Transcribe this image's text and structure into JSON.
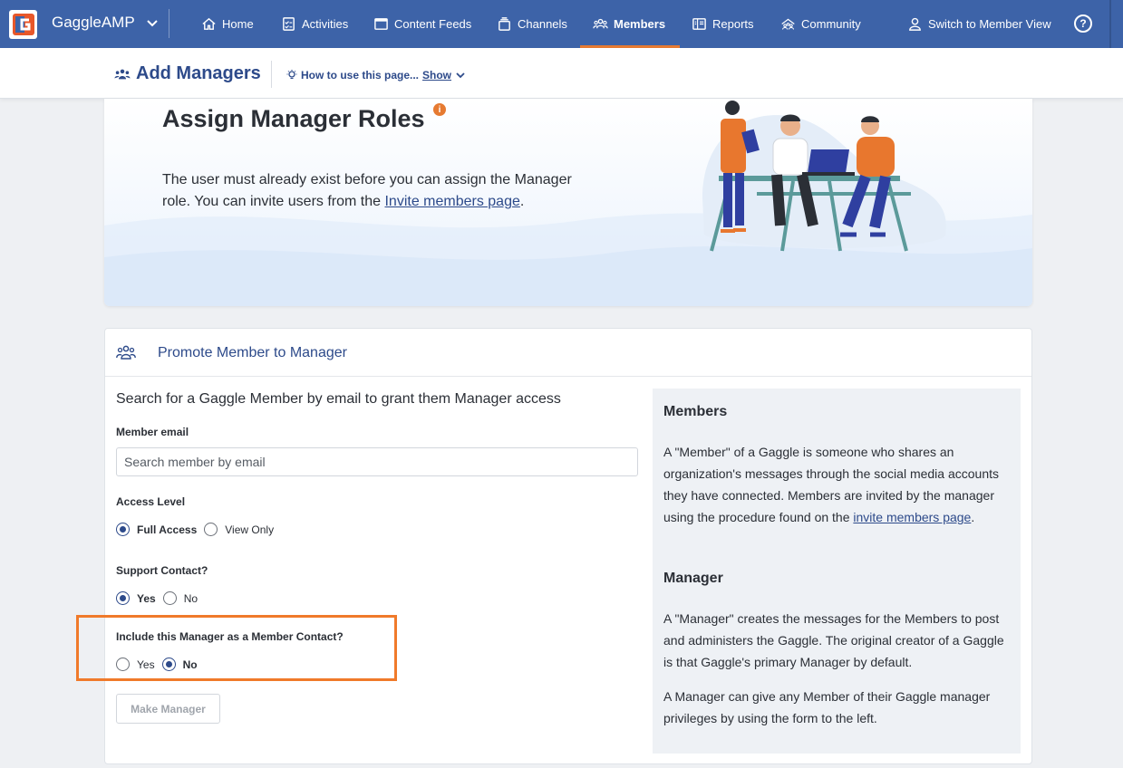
{
  "nav": {
    "brand": "GaggleAMP",
    "items": [
      {
        "label": "Home",
        "icon": "home-icon"
      },
      {
        "label": "Activities",
        "icon": "checklist-icon"
      },
      {
        "label": "Content Feeds",
        "icon": "feed-icon"
      },
      {
        "label": "Channels",
        "icon": "layers-icon"
      },
      {
        "label": "Members",
        "icon": "people-icon"
      },
      {
        "label": "Reports",
        "icon": "book-icon"
      },
      {
        "label": "Community",
        "icon": "community-icon"
      }
    ],
    "active": "Members",
    "member_view": "Switch to Member View",
    "help": "?"
  },
  "subheader": {
    "title": "Add Managers",
    "howto": "How to use this page...",
    "show": "Show"
  },
  "hero": {
    "title": "Assign Manager Roles",
    "text_before": "The user must already exist before you can assign the Manager role. You can invite users from the ",
    "link": "Invite members page",
    "text_after": "."
  },
  "card": {
    "title": "Promote Member to Manager",
    "search_desc": "Search for a Gaggle Member by email to grant them Manager access",
    "email_label": "Member email",
    "email_placeholder": "Search member by email",
    "access_label": "Access Level",
    "access_options": [
      "Full Access",
      "View Only"
    ],
    "access_selected": "Full Access",
    "support_label": "Support Contact?",
    "support_options": [
      "Yes",
      "No"
    ],
    "support_selected": "Yes",
    "contact_label": "Include this Manager as a Member Contact?",
    "contact_options": [
      "Yes",
      "No"
    ],
    "contact_selected": "No",
    "submit": "Make Manager"
  },
  "sidebar": {
    "members_title": "Members",
    "members_text": "A \"Member\" of a Gaggle is someone who shares an organization's messages through the social media accounts they have connected. Members are invited by the manager using the procedure found on the ",
    "members_link": "invite members page",
    "members_text_end": ".",
    "manager_title": "Manager",
    "manager_text1": "A \"Manager\" creates the messages for the Members to post and administers the Gaggle. The original creator of a Gaggle is that Gaggle's primary Manager by default.",
    "manager_text2": "A Manager can give any Member of their Gaggle manager privileges by using the form to the left."
  },
  "colors": {
    "nav": "#3d63a8",
    "accent": "#e67a31",
    "primary": "#2d4a8a",
    "highlight": "#f07a2a"
  }
}
